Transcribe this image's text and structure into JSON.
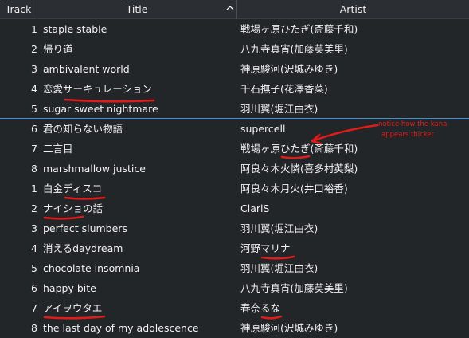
{
  "header": {
    "track": "Track",
    "title": "Title",
    "artist": "Artist"
  },
  "rows": [
    {
      "track": "1",
      "title": "staple stable",
      "artist": "戦場ヶ原ひたぎ(斎藤千和)"
    },
    {
      "track": "2",
      "title": "帰り道",
      "artist": "八九寺真宵(加藤英美里)"
    },
    {
      "track": "3",
      "title": "ambivalent world",
      "artist": "神原駿河(沢城みゆき)"
    },
    {
      "track": "4",
      "title": "恋愛サーキュレーション",
      "artist": "千石撫子(花澤香菜)"
    },
    {
      "track": "5",
      "title": "sugar sweet nightmare",
      "artist": "羽川翼(堀江由衣)"
    },
    {
      "track": "6",
      "title": "君の知らない物語",
      "artist": "supercell"
    },
    {
      "track": "7",
      "title": "二言目",
      "artist": "戦場ヶ原ひたぎ(斎藤千和)"
    },
    {
      "track": "8",
      "title": "marshmallow justice",
      "artist": "阿良々木火憐(喜多村英梨)"
    },
    {
      "track": "1",
      "title": "白金ディスコ",
      "artist": "阿良々木月火(井口裕香)"
    },
    {
      "track": "2",
      "title": "ナイショの話",
      "artist": "ClariS"
    },
    {
      "track": "3",
      "title": "perfect slumbers",
      "artist": "羽川翼(堀江由衣)"
    },
    {
      "track": "4",
      "title": "消えるdaydream",
      "artist": "河野マリナ"
    },
    {
      "track": "5",
      "title": "chocolate insomnia",
      "artist": "羽川翼(堀江由衣)"
    },
    {
      "track": "6",
      "title": "happy bite",
      "artist": "八九寺真宵(加藤英美里)"
    },
    {
      "track": "7",
      "title": "アイヲウタエ",
      "artist": "春奈るな"
    },
    {
      "track": "8",
      "title": "the last day of my adolescence",
      "artist": "神原駿河(沢城みゆき)"
    }
  ],
  "annotation": {
    "line1": "notice how the kana",
    "line2": "appears thicker",
    "color": "#e01b1b"
  },
  "colors": {
    "background": "#232629",
    "header": "#2b2f34",
    "separator": "#3d8fd6",
    "text": "#eff0f1"
  }
}
